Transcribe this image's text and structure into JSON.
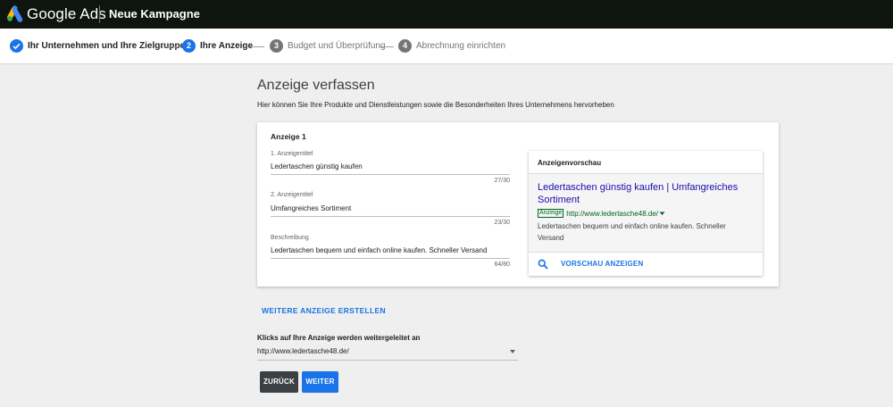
{
  "header": {
    "brand": "Google Ads",
    "campaign_title": "Neue Kampagne"
  },
  "stepper": {
    "steps": [
      {
        "number": "",
        "label": "Ihr Unternehmen und Ihre Zielgruppe",
        "status": "done"
      },
      {
        "number": "2",
        "label": "Ihre Anzeige",
        "status": "active"
      },
      {
        "number": "3",
        "label": "Budget und Überprüfung",
        "status": "pending"
      },
      {
        "number": "4",
        "label": "Abrechnung einrichten",
        "status": "pending"
      }
    ]
  },
  "main": {
    "title": "Anzeige verfassen",
    "subtitle": "Hier können Sie Ihre Produkte und Dienstleistungen sowie die Besonderheiten Ihres Unternehmens hervorheben"
  },
  "ad_card": {
    "title": "Anzeige 1",
    "fields": [
      {
        "label": "1. Anzeigentitel",
        "value": "Ledertaschen günstig kaufen",
        "counter": "27/30"
      },
      {
        "label": "2. Anzeigentitel",
        "value": "Umfangreiches Sortiment",
        "counter": "23/30"
      },
      {
        "label": "Beschreibung",
        "value": "Ledertaschen bequem und einfach online kaufen. Schneller Versand",
        "counter": "64/80"
      }
    ]
  },
  "preview": {
    "heading": "Anzeigenvorschau",
    "headline": "Ledertaschen günstig kaufen | Umfangreiches Sortiment",
    "badge": "Anzeige",
    "url": "http://www.ledertasche48.de/",
    "description": "Ledertaschen bequem und einfach online kaufen. Schneller Versand",
    "action_label": "VORSCHAU ANZEIGEN"
  },
  "another_ad_link": "WEITERE ANZEIGE ERSTELLEN",
  "redirect": {
    "label": "Klicks auf Ihre Anzeige werden weitergeleitet an",
    "value": "http://www.ledertasche48.de/"
  },
  "buttons": {
    "back": "ZURÜCK",
    "next": "WEITER"
  },
  "colors": {
    "topbar": "#0e140e",
    "primary": "#1a73e8",
    "step_pending": "#757575",
    "ad_link": "#1a0dab",
    "ad_url": "#006621"
  }
}
